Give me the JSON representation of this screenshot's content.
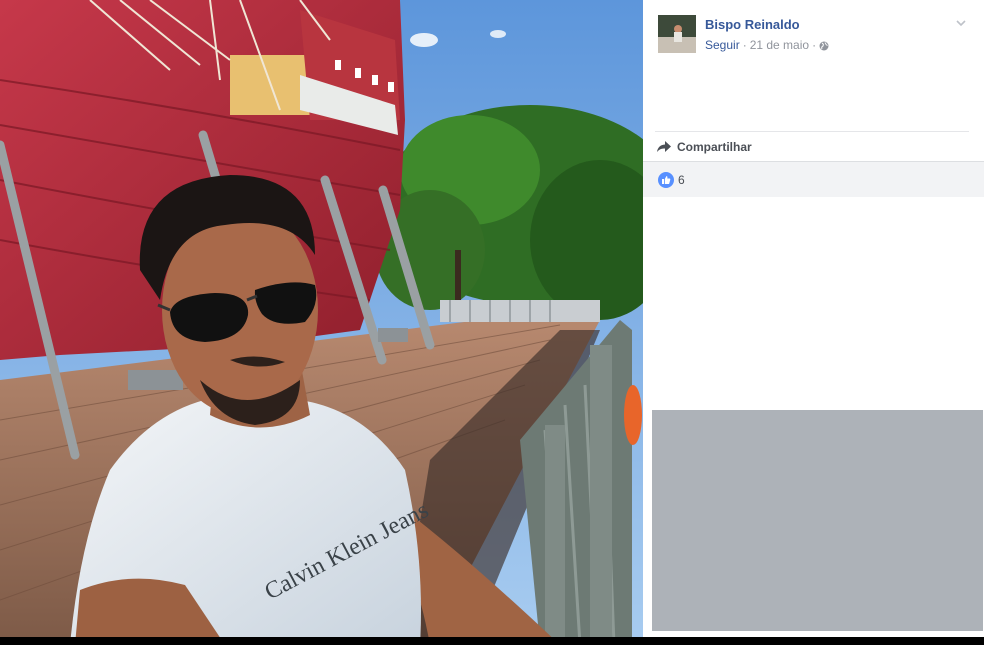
{
  "post": {
    "author": "Bispo Reinaldo",
    "follow_label": "Seguir",
    "separator": "·",
    "date": "21 de maio",
    "privacy_icon": "globe-icon",
    "share_label": "Compartilhar",
    "like_count": "6"
  },
  "photo": {
    "shirt_text": "Calvin Klein Jeans"
  },
  "colors": {
    "link": "#365899",
    "meta": "#90949c",
    "like_blue": "#5890ff",
    "reaction_bg": "#f2f3f5"
  }
}
